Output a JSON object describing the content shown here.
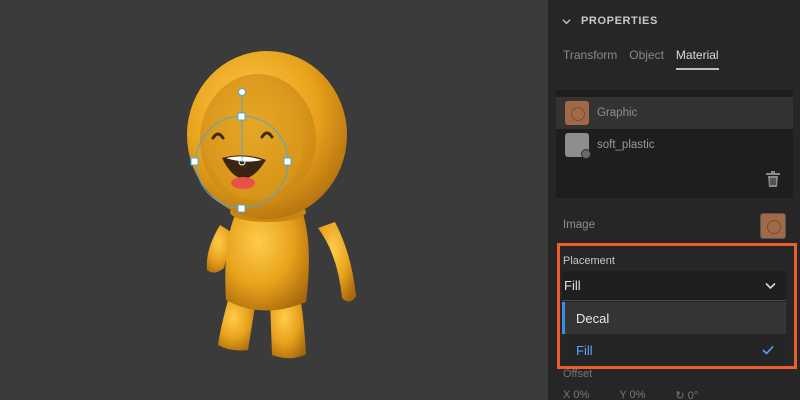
{
  "panel": {
    "section_title": "PROPERTIES",
    "tabs": [
      {
        "label": "Transform",
        "active": false
      },
      {
        "label": "Object",
        "active": false
      },
      {
        "label": "Material",
        "active": true
      }
    ],
    "materials": [
      {
        "name": "Graphic",
        "selected": true,
        "icon": "image-swatch-icon"
      },
      {
        "name": "soft_plastic",
        "selected": false,
        "icon": "material-swatch-icon"
      }
    ],
    "image_label": "Image",
    "placement": {
      "label": "Placement",
      "value": "Fill",
      "options": [
        "Decal",
        "Fill"
      ],
      "selected_option": "Fill"
    },
    "offset": {
      "label": "Offset",
      "x_label": "X",
      "x_value": "0%",
      "y_label": "Y",
      "y_value": "0%",
      "rotation_value": "0°"
    }
  },
  "colors": {
    "accent_blue": "#58a4ff",
    "highlight": "#ec5e2c",
    "character": "#e8a21c"
  }
}
